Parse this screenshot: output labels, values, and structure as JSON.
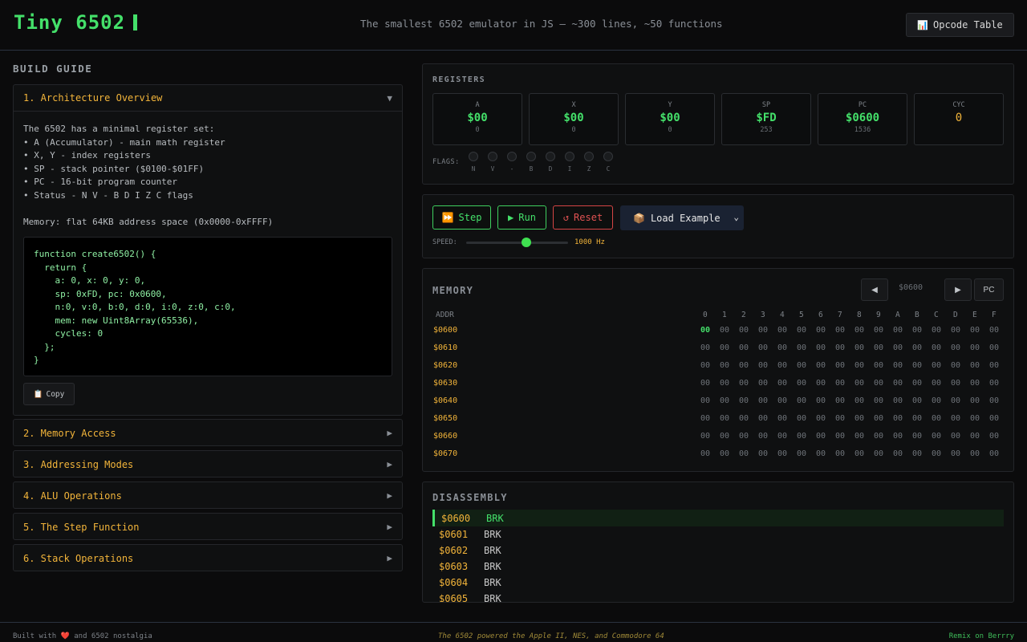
{
  "header": {
    "title": "Tiny 6502",
    "tagline": "The smallest 6502 emulator in JS — ~300 lines, ~50 functions",
    "opcode_button": "Opcode Table",
    "opcode_icon": "chart-icon"
  },
  "guide": {
    "title": "BUILD GUIDE",
    "sections": [
      {
        "label": "1. Architecture Overview",
        "expanded": true,
        "body": "The 6502 has a minimal register set:\n• A (Accumulator) - main math register\n• X, Y - index registers\n• SP - stack pointer ($0100-$01FF)\n• PC - 16-bit program counter\n• Status - N V - B D I Z C flags\n\nMemory: flat 64KB address space (0x0000-0xFFFF)",
        "code": "function create6502() {\n  return {\n    a: 0, x: 0, y: 0,\n    sp: 0xFD, pc: 0x0600,\n    n:0, v:0, b:0, d:0, i:0, z:0, c:0,\n    mem: new Uint8Array(65536),\n    cycles: 0\n  };\n}",
        "copy_label": "Copy"
      },
      {
        "label": "2. Memory Access",
        "expanded": false
      },
      {
        "label": "3. Addressing Modes",
        "expanded": false
      },
      {
        "label": "4. ALU Operations",
        "expanded": false
      },
      {
        "label": "5. The Step Function",
        "expanded": false
      },
      {
        "label": "6. Stack Operations",
        "expanded": false
      }
    ]
  },
  "registers": {
    "title": "REGISTERS",
    "items": [
      {
        "name": "A",
        "hex": "$00",
        "dec": "0"
      },
      {
        "name": "X",
        "hex": "$00",
        "dec": "0"
      },
      {
        "name": "Y",
        "hex": "$00",
        "dec": "0"
      },
      {
        "name": "SP",
        "hex": "$FD",
        "dec": "253"
      },
      {
        "name": "PC",
        "hex": "$0600",
        "dec": "1536"
      },
      {
        "name": "CYC",
        "hex": "0",
        "dec": ""
      }
    ],
    "flags_label": "FLAGS:",
    "flags": [
      "N",
      "V",
      "-",
      "B",
      "D",
      "I",
      "Z",
      "C"
    ]
  },
  "controls": {
    "step": "Step",
    "run": "Run",
    "reset": "Reset",
    "load": "Load Example",
    "speed_label": "SPEED:",
    "speed_value": "1000 Hz",
    "speed_fraction": 0.59
  },
  "memory": {
    "title": "MEMORY",
    "prev": "◀",
    "next": "▶",
    "address": "$0600",
    "pc_button": "PC",
    "addr_header": "ADDR",
    "columns": [
      "0",
      "1",
      "2",
      "3",
      "4",
      "5",
      "6",
      "7",
      "8",
      "9",
      "A",
      "B",
      "C",
      "D",
      "E",
      "F"
    ],
    "rows": [
      {
        "addr": "$0600",
        "bytes": [
          "00",
          "00",
          "00",
          "00",
          "00",
          "00",
          "00",
          "00",
          "00",
          "00",
          "00",
          "00",
          "00",
          "00",
          "00",
          "00"
        ]
      },
      {
        "addr": "$0610",
        "bytes": [
          "00",
          "00",
          "00",
          "00",
          "00",
          "00",
          "00",
          "00",
          "00",
          "00",
          "00",
          "00",
          "00",
          "00",
          "00",
          "00"
        ]
      },
      {
        "addr": "$0620",
        "bytes": [
          "00",
          "00",
          "00",
          "00",
          "00",
          "00",
          "00",
          "00",
          "00",
          "00",
          "00",
          "00",
          "00",
          "00",
          "00",
          "00"
        ]
      },
      {
        "addr": "$0630",
        "bytes": [
          "00",
          "00",
          "00",
          "00",
          "00",
          "00",
          "00",
          "00",
          "00",
          "00",
          "00",
          "00",
          "00",
          "00",
          "00",
          "00"
        ]
      },
      {
        "addr": "$0640",
        "bytes": [
          "00",
          "00",
          "00",
          "00",
          "00",
          "00",
          "00",
          "00",
          "00",
          "00",
          "00",
          "00",
          "00",
          "00",
          "00",
          "00"
        ]
      },
      {
        "addr": "$0650",
        "bytes": [
          "00",
          "00",
          "00",
          "00",
          "00",
          "00",
          "00",
          "00",
          "00",
          "00",
          "00",
          "00",
          "00",
          "00",
          "00",
          "00"
        ]
      },
      {
        "addr": "$0660",
        "bytes": [
          "00",
          "00",
          "00",
          "00",
          "00",
          "00",
          "00",
          "00",
          "00",
          "00",
          "00",
          "00",
          "00",
          "00",
          "00",
          "00"
        ]
      },
      {
        "addr": "$0670",
        "bytes": [
          "00",
          "00",
          "00",
          "00",
          "00",
          "00",
          "00",
          "00",
          "00",
          "00",
          "00",
          "00",
          "00",
          "00",
          "00",
          "00"
        ]
      }
    ]
  },
  "disassembly": {
    "title": "DISASSEMBLY",
    "lines": [
      {
        "addr": "$0600",
        "mnemonic": "BRK",
        "current": true
      },
      {
        "addr": "$0601",
        "mnemonic": "BRK",
        "current": false
      },
      {
        "addr": "$0602",
        "mnemonic": "BRK",
        "current": false
      },
      {
        "addr": "$0603",
        "mnemonic": "BRK",
        "current": false
      },
      {
        "addr": "$0604",
        "mnemonic": "BRK",
        "current": false
      },
      {
        "addr": "$0605",
        "mnemonic": "BRK",
        "current": false
      }
    ]
  },
  "footer": {
    "left_prefix": "Built with",
    "left_suffix": "and 6502 nostalgia",
    "center": "The 6502 powered the Apple II, NES, and Commodore 64",
    "right": "Remix on Berrry"
  },
  "colors": {
    "accent_green": "#44e06a",
    "accent_orange": "#f2b43a",
    "danger": "#e05252",
    "background": "#0b0b0c"
  }
}
